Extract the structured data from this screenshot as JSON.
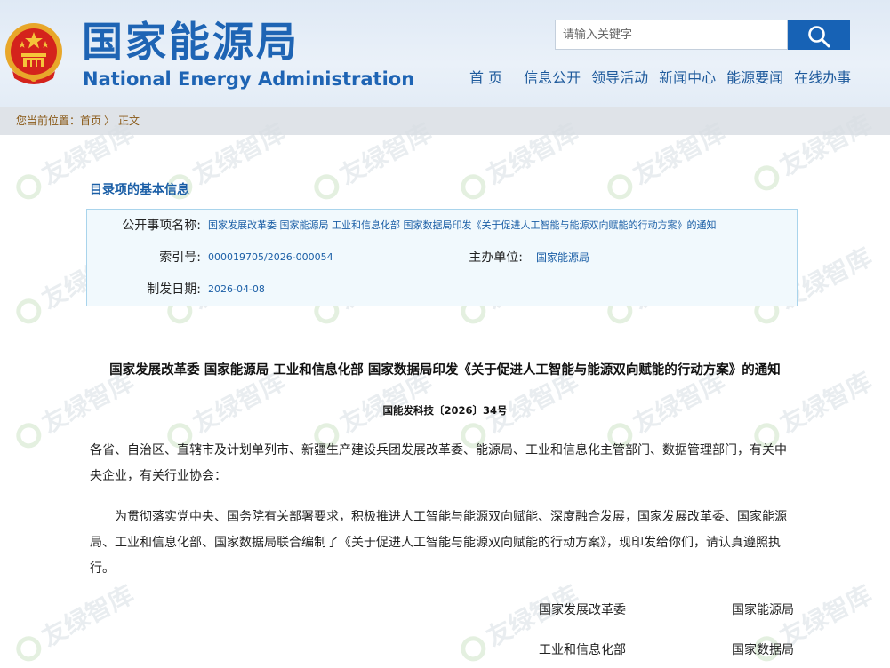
{
  "header": {
    "site_name_cn": "国家能源局",
    "site_name_en": "National Energy Administration",
    "search_placeholder": "请输入关键字",
    "nav": [
      "首 页",
      "信息公开",
      "领导活动",
      "新闻中心",
      "能源要闻",
      "在线办事"
    ]
  },
  "breadcrumb": {
    "prefix": "您当前位置：",
    "home": "首页",
    "separator": "〉",
    "current": "正文"
  },
  "watermark": "友绿智库",
  "info": {
    "section_title": "目录项的基本信息",
    "name_label": "公开事项名称:",
    "name_value": "国家发展改革委 国家能源局 工业和信息化部 国家数据局印发《关于促进人工智能与能源双向赋能的行动方案》的通知",
    "index_label": "索引号:",
    "index_value": "000019705/2026-000054",
    "org_label": "主办单位:",
    "org_value": "国家能源局",
    "date_label": "制发日期:",
    "date_value": "2026-04-08"
  },
  "document": {
    "title": "国家发展改革委  国家能源局  工业和信息化部  国家数据局印发《关于促进人工智能与能源双向赋能的行动方案》的通知",
    "doc_number": "国能发科技〔2026〕34号",
    "addressee": "各省、自治区、直辖市及计划单列市、新疆生产建设兵团发展改革委、能源局、工业和信息化主管部门、数据管理部门，有关中央企业，有关行业协会：",
    "body": "为贯彻落实党中央、国务院有关部署要求，积极推进人工智能与能源双向赋能、深度融合发展，国家发展改革委、国家能源局、工业和信息化部、国家数据局联合编制了《关于促进人工智能与能源双向赋能的行动方案》，现印发给你们，请认真遵照执行。",
    "signatories": [
      "国家发展改革委",
      "国家能源局",
      "工业和信息化部",
      "国家数据局"
    ]
  },
  "colors": {
    "brand_blue": "#1e64b4",
    "search_button": "#1762b5",
    "breadcrumb_text": "#8a5a18",
    "info_border": "#a9d4ec"
  }
}
